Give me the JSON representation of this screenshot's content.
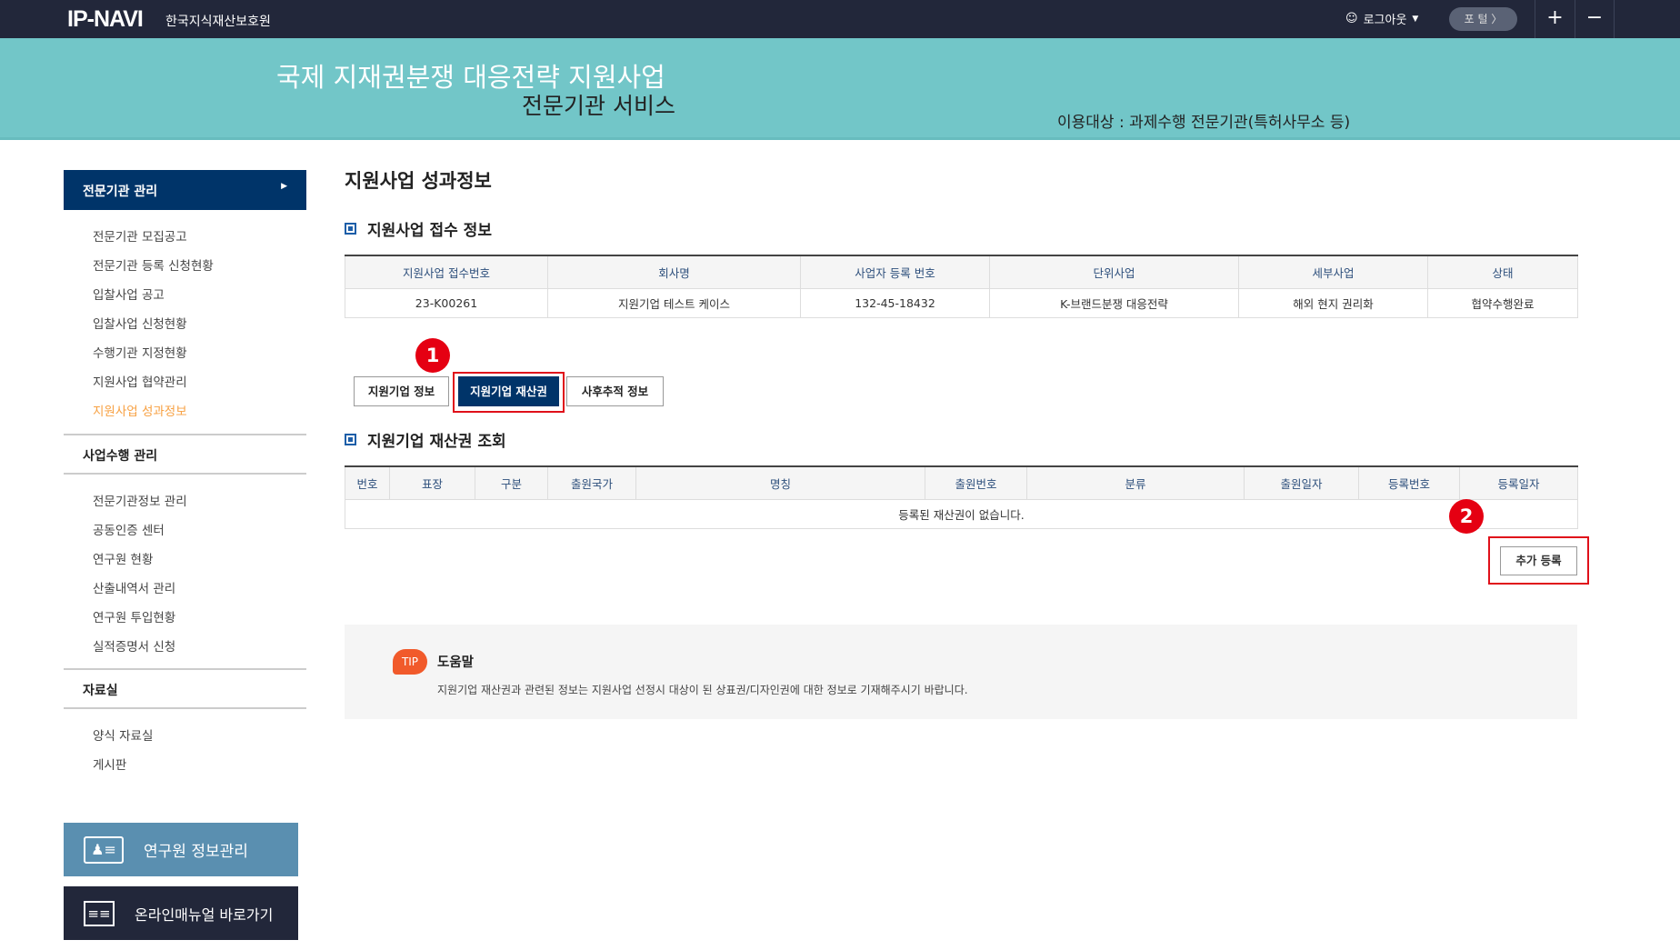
{
  "topbar": {
    "logo": "IP-NAVI",
    "org": "한국지식재산보호원",
    "logout": "로그아웃",
    "portal": "포 털 〉",
    "plus": "+",
    "minus": "−"
  },
  "banner": {
    "title": "국제 지재권분쟁 대응전략 지원사업",
    "subtitle": "전문기관 서비스",
    "target": "이용대상 : 과제수행 전문기관(특허사무소 등)"
  },
  "sidebar": {
    "section1": "전문기관 관리",
    "items1": [
      "전문기관 모집공고",
      "전문기관 등록 신청현황",
      "입찰사업 공고",
      "입찰사업 신청현황",
      "수행기관 지정현황",
      "지원사업 협약관리",
      "지원사업 성과정보"
    ],
    "section2": "사업수행 관리",
    "items2": [
      "전문기관정보 관리",
      "공동인증 센터",
      "연구원 현황",
      "산출내역서 관리",
      "연구원 투입현황",
      "실적증명서 신청"
    ],
    "section3": "자료실",
    "items3": [
      "양식 자료실",
      "게시판"
    ],
    "btn_researcher": "연구원 정보관리",
    "btn_manual": "온라인매뉴얼 바로가기"
  },
  "main": {
    "title": "지원사업 성과정보",
    "section1": "지원사업 접수 정보",
    "table1": {
      "headers": [
        "지원사업 접수번호",
        "회사명",
        "사업자 등록 번호",
        "단위사업",
        "세부사업",
        "상태"
      ],
      "row": [
        "23-K00261",
        "지원기업 테스트 케이스",
        "132-45-18432",
        "K-브랜드분쟁 대응전략",
        "해외 현지 권리화",
        "협약수행완료"
      ]
    },
    "tabs": [
      "지원기업 정보",
      "지원기업 재산권",
      "사후추적 정보"
    ],
    "badge1": "1",
    "badge2": "2",
    "section2": "지원기업 재산권 조회",
    "table2": {
      "headers": [
        "번호",
        "표장",
        "구분",
        "출원국가",
        "명칭",
        "출원번호",
        "분류",
        "출원일자",
        "등록번호",
        "등록일자"
      ],
      "empty": "등록된 재산권이 없습니다."
    },
    "add_button": "추가 등록",
    "tip": {
      "icon": "TIP",
      "title": "도움말",
      "text": "지원기업 재산권과 관련된 정보는 지원사업 선정시 대상이 된 상표권/디자인권에 대한 정보로 기재해주시기 바랍니다."
    }
  }
}
